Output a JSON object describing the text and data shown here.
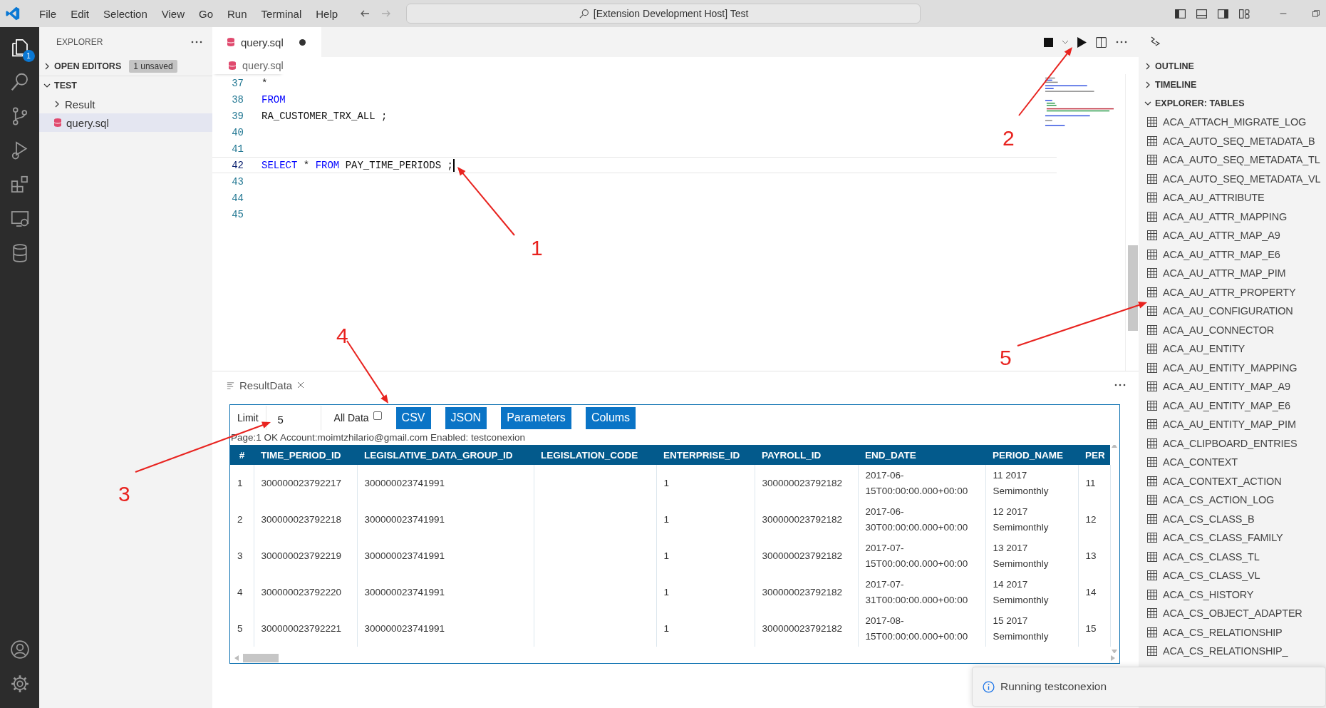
{
  "title_bar": {
    "menu": [
      "File",
      "Edit",
      "Selection",
      "View",
      "Go",
      "Run",
      "Terminal",
      "Help"
    ],
    "command_center": "[Extension Development Host] Test"
  },
  "activity_bar": {
    "explorer_badge": "1"
  },
  "explorer": {
    "title": "EXPLORER",
    "open_editors": {
      "label": "OPEN EDITORS",
      "badge": "1 unsaved",
      "expanded": false
    },
    "folder": {
      "label": "TEST",
      "expanded": true,
      "children": [
        {
          "label": "Result",
          "kind": "folder",
          "expanded": false,
          "selected": false
        },
        {
          "label": "query.sql",
          "kind": "file",
          "selected": true
        }
      ]
    }
  },
  "editor": {
    "tab": {
      "label": "query.sql",
      "dirty": true
    },
    "breadcrumb": "query.sql",
    "lines": [
      {
        "number": "37",
        "current": false,
        "tokens": [
          {
            "kind": "text",
            "text": "*"
          }
        ]
      },
      {
        "number": "38",
        "current": false,
        "tokens": [
          {
            "kind": "keyword",
            "text": "FROM"
          }
        ]
      },
      {
        "number": "39",
        "current": false,
        "tokens": [
          {
            "kind": "text",
            "text": "RA_CUSTOMER_TRX_ALL ;"
          }
        ]
      },
      {
        "number": "40",
        "current": false
      },
      {
        "number": "41",
        "current": false
      },
      {
        "number": "42",
        "current": true,
        "tokens": [
          {
            "kind": "keyword",
            "text": "SELECT"
          },
          {
            "kind": "text",
            "text": " * "
          },
          {
            "kind": "keyword",
            "text": "FROM"
          },
          {
            "kind": "text",
            "text": " PAY_TIME_PERIODS ;"
          }
        ]
      },
      {
        "number": "43",
        "current": false
      },
      {
        "number": "44",
        "current": false
      },
      {
        "number": "45",
        "current": false
      }
    ]
  },
  "side_panel": {
    "sections": [
      {
        "label": "OUTLINE",
        "expanded": false
      },
      {
        "label": "TIMELINE",
        "expanded": false
      },
      {
        "label": "EXPLORER: TABLES",
        "expanded": true
      }
    ],
    "tables": [
      "ACA_ATTACH_MIGRATE_LOG",
      "ACA_AUTO_SEQ_METADATA_B",
      "ACA_AUTO_SEQ_METADATA_TL",
      "ACA_AUTO_SEQ_METADATA_VL",
      "ACA_AU_ATTRIBUTE",
      "ACA_AU_ATTR_MAPPING",
      "ACA_AU_ATTR_MAP_A9",
      "ACA_AU_ATTR_MAP_E6",
      "ACA_AU_ATTR_MAP_PIM",
      "ACA_AU_ATTR_PROPERTY",
      "ACA_AU_CONFIGURATION",
      "ACA_AU_CONNECTOR",
      "ACA_AU_ENTITY",
      "ACA_AU_ENTITY_MAPPING",
      "ACA_AU_ENTITY_MAP_A9",
      "ACA_AU_ENTITY_MAP_E6",
      "ACA_AU_ENTITY_MAP_PIM",
      "ACA_CLIPBOARD_ENTRIES",
      "ACA_CONTEXT",
      "ACA_CONTEXT_ACTION",
      "ACA_CS_ACTION_LOG",
      "ACA_CS_CLASS_B",
      "ACA_CS_CLASS_FAMILY",
      "ACA_CS_CLASS_TL",
      "ACA_CS_CLASS_VL",
      "ACA_CS_HISTORY",
      "ACA_CS_OBJECT_ADAPTER",
      "ACA_CS_RELATIONSHIP",
      "ACA_CS_RELATIONSHIP_"
    ]
  },
  "panel": {
    "tab": "ResultData",
    "limit_label": "Limit",
    "limit": "5",
    "all_data_label": "All Data",
    "all_data": false,
    "buttons": [
      "CSV",
      "JSON",
      "Parameters",
      "Colums"
    ],
    "status": "Page:1 OK Account:moimtzhilario@gmail.com Enabled: testconexion",
    "columns": [
      "#",
      "TIME_PERIOD_ID",
      "LEGISLATIVE_DATA_GROUP_ID",
      "LEGISLATION_CODE",
      "ENTERPRISE_ID",
      "PAYROLL_ID",
      "END_DATE",
      "PERIOD_NAME",
      "PER"
    ],
    "rows": [
      [
        "1",
        "300000023792217",
        "300000023741991",
        null,
        "1",
        "300000023792182",
        "2017-06-15T00:00:00.000+00:00",
        "11 2017 Semimonthly",
        "11"
      ],
      [
        "2",
        "300000023792218",
        "300000023741991",
        null,
        "1",
        "300000023792182",
        "2017-06-30T00:00:00.000+00:00",
        "12 2017 Semimonthly",
        "12"
      ],
      [
        "3",
        "300000023792219",
        "300000023741991",
        null,
        "1",
        "300000023792182",
        "2017-07-15T00:00:00.000+00:00",
        "13 2017 Semimonthly",
        "13"
      ],
      [
        "4",
        "300000023792220",
        "300000023741991",
        null,
        "1",
        "300000023792182",
        "2017-07-31T00:00:00.000+00:00",
        "14 2017 Semimonthly",
        "14"
      ],
      [
        "5",
        "300000023792221",
        "300000023741991",
        null,
        "1",
        "300000023792182",
        "2017-08-15T00:00:00.000+00:00",
        "15 2017 Semimonthly",
        "15"
      ]
    ]
  },
  "notification": {
    "text": "Running testconexion"
  },
  "annotations": [
    "1",
    "2",
    "3",
    "4",
    "5"
  ]
}
